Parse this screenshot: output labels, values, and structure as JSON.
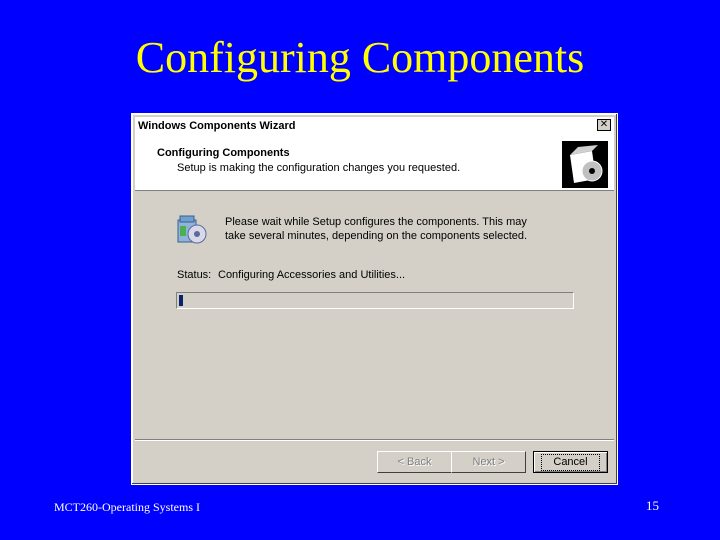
{
  "slide": {
    "title": "Configuring Components",
    "footer_left": "MCT260-Operating Systems I",
    "page_number": "15"
  },
  "dialog": {
    "window_title": "Windows Components Wizard",
    "close_glyph": "✕",
    "header_title": "Configuring Components",
    "header_subtitle": "Setup is making the configuration changes you requested.",
    "message": "Please wait while Setup configures the components. This may take several minutes, depending on the components selected.",
    "status_label": "Status:",
    "status_value": "Configuring Accessories and Utilities...",
    "progress_fraction": 0.01,
    "buttons": {
      "back": "< Back",
      "next": "Next >",
      "cancel": "Cancel"
    }
  },
  "colors": {
    "slide_background": "#0000FF",
    "title_color": "#FFFF00",
    "progress_color": "#0A246A"
  },
  "icons": {
    "header": "box-with-cd-icon",
    "body": "components-setup-icon"
  }
}
